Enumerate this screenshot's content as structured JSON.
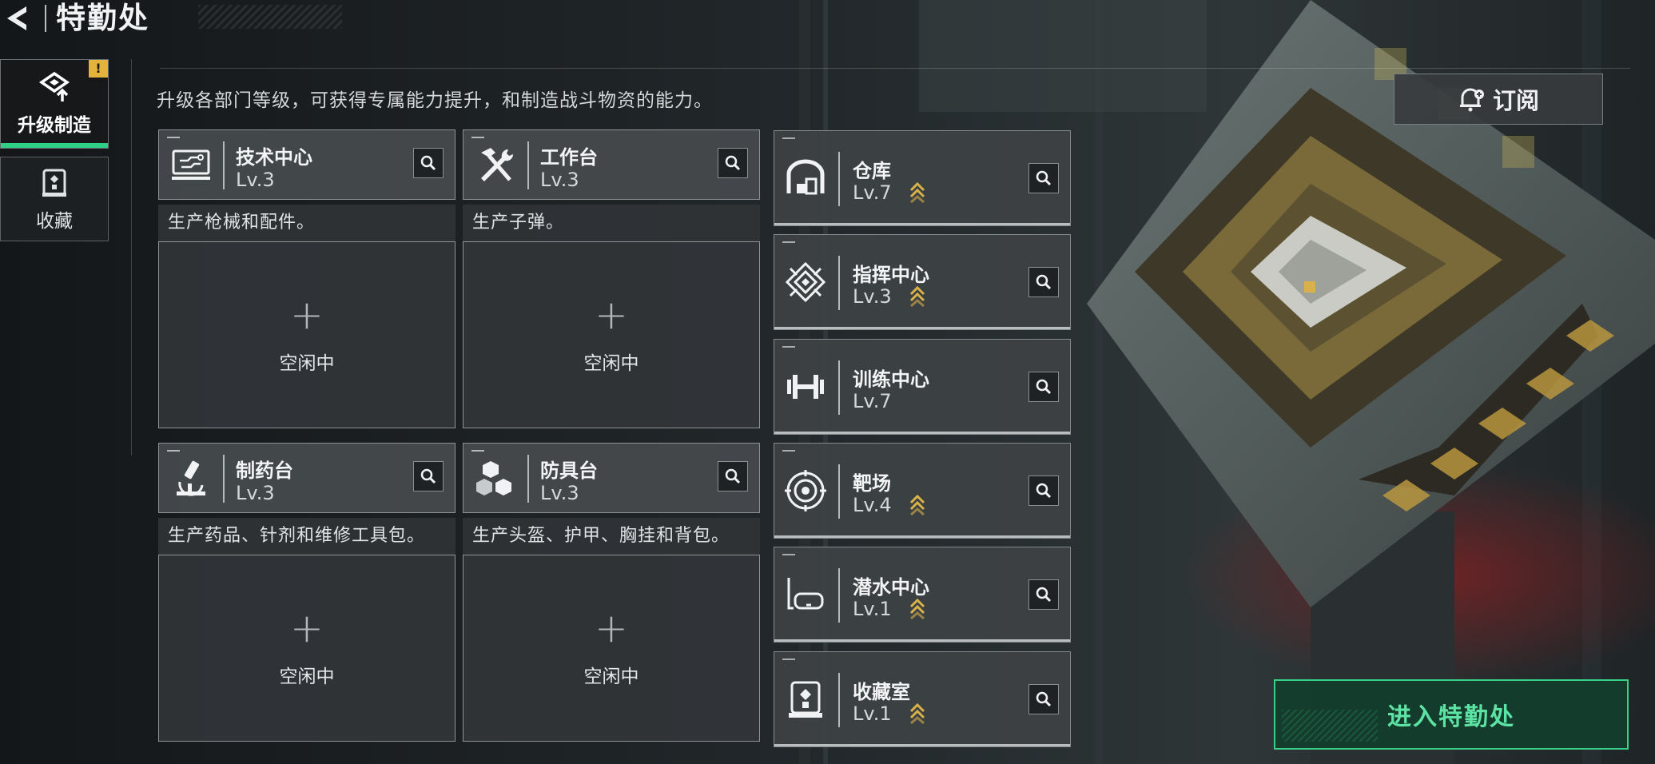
{
  "header": {
    "title": "特勤处"
  },
  "nav": {
    "items": [
      {
        "label": "升级制造",
        "icon": "upgrade-icon",
        "active": true,
        "badge": "!"
      },
      {
        "label": "收藏",
        "icon": "collection-cabinet-icon",
        "active": false
      }
    ]
  },
  "subtitle": "升级各部门等级，可获得专属能力提升，和制造战斗物资的能力。",
  "subscribe": {
    "label": "订阅",
    "icon": "bell-subscribe-icon"
  },
  "production": [
    {
      "name": "技术中心",
      "level": "Lv.3",
      "desc": "生产枪械和配件。",
      "icon": "computer-icon",
      "slot_plus": "+",
      "slot_label": "空闲中"
    },
    {
      "name": "工作台",
      "level": "Lv.3",
      "desc": "生产子弹。",
      "icon": "hammer-wrench-icon",
      "slot_plus": "+",
      "slot_label": "空闲中"
    },
    {
      "name": "制药台",
      "level": "Lv.3",
      "desc": "生产药品、针剂和维修工具包。",
      "icon": "microscope-icon",
      "slot_plus": "+",
      "slot_label": "空闲中"
    },
    {
      "name": "防具台",
      "level": "Lv.3",
      "desc": "生产头盔、护甲、胸挂和背包。",
      "icon": "cubes-icon",
      "slot_plus": "+",
      "slot_label": "空闲中"
    }
  ],
  "facilities": [
    {
      "name": "仓库",
      "level": "Lv.7",
      "icon": "warehouse-icon",
      "upgrade_available": true
    },
    {
      "name": "指挥中心",
      "level": "Lv.3",
      "icon": "command-emblem-icon",
      "upgrade_available": true
    },
    {
      "name": "训练中心",
      "level": "Lv.7",
      "icon": "dumbbell-icon",
      "upgrade_available": false
    },
    {
      "name": "靶场",
      "level": "Lv.4",
      "icon": "target-icon",
      "upgrade_available": true
    },
    {
      "name": "潜水中心",
      "level": "Lv.1",
      "icon": "diving-mask-icon",
      "upgrade_available": true
    },
    {
      "name": "收藏室",
      "level": "Lv.1",
      "icon": "collection-cabinet-icon",
      "upgrade_available": true
    }
  ],
  "enter_button": {
    "label": "进入特勤处"
  },
  "colors": {
    "accent_green": "#39cf88",
    "upgrade_gold": "#d8b14a",
    "badge_yellow": "#e4b43a"
  }
}
